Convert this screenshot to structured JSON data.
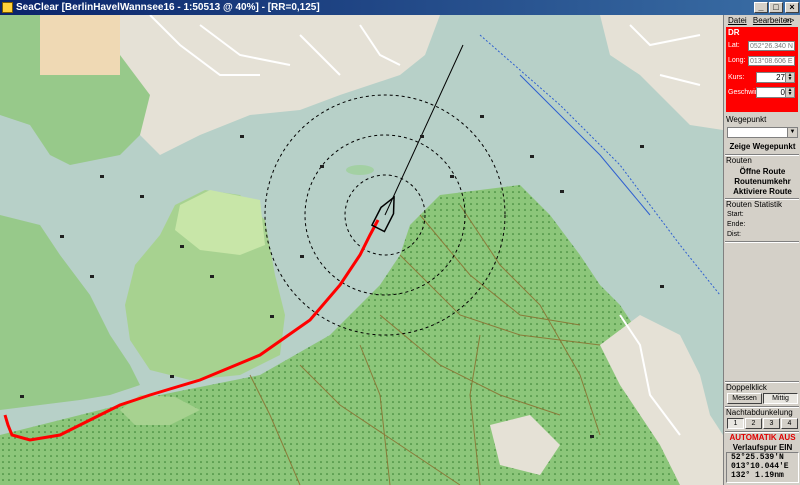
{
  "window": {
    "title": "SeaClear [BerlinHavelWannsee16 - 1:50513 @ 40%] - [RR=0,125]",
    "buttons": {
      "minimize": "_",
      "maximize": "□",
      "close": "×"
    }
  },
  "panel": {
    "menu": {
      "datei": "Datei",
      "bearbeiten": "Bearbeiten",
      "more": ">>"
    },
    "dr": {
      "header": "DR",
      "lat_label": "Lat:",
      "lat_value": "052°26.340 N",
      "long_label": "Long:",
      "long_value": "013°08.606 E",
      "kurs_label": "Kurs:",
      "kurs_value": "27",
      "geschw_label": "Geschwin",
      "geschw_value": "0"
    },
    "wegepunkt": {
      "label": "Wegepunkt",
      "selected": "",
      "show_button": "Zeige Wegepunkt"
    },
    "routen": {
      "label": "Routen",
      "open": "Öffne Route",
      "reverse": "Routenumkehr",
      "activate": "Aktiviere Route"
    },
    "statistik": {
      "label": "Routen Statistik",
      "start": "Start:",
      "ende": "Ende:",
      "dist": "Dist:"
    },
    "doppelklick": {
      "label": "Doppelklick",
      "messen": "Messen",
      "mittig": "Mittig"
    },
    "nacht": {
      "label": "Nachtabdunkelung",
      "levels": [
        "1",
        "2",
        "3",
        "4"
      ]
    },
    "automatik": "AUTOMATIK AUS",
    "verlaufspur": "Verlaufspur EIN",
    "position": {
      "lat": "52°25.539'N",
      "lon": "013°10.044'E",
      "course": "132°  1.19nm"
    }
  },
  "map": {
    "colors": {
      "water": "#b7d0c8",
      "land": "#97c98a",
      "forest": "#85c073",
      "residential": "#e5e1d6",
      "track": "#ff0000"
    },
    "icons": [
      "buoy-icon",
      "boat-icon",
      "range-ring-icon"
    ]
  }
}
